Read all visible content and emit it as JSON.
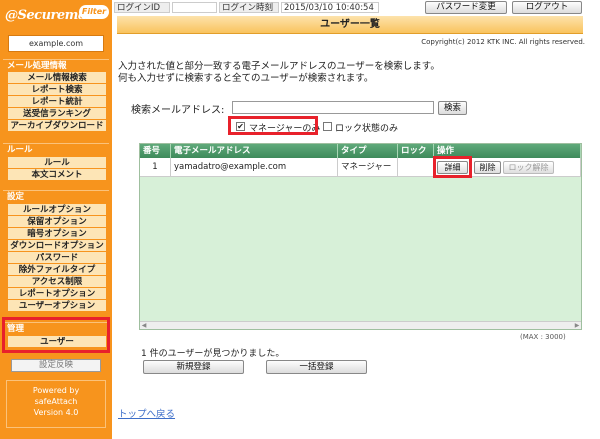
{
  "sidebar": {
    "logo_text": "@Securemail",
    "logo_badge": "Filter",
    "domain": "example.com",
    "sections": [
      {
        "title": "メール処理情報",
        "items": [
          "メール情報検索",
          "レポート検索",
          "レポート統計",
          "送受信ランキング",
          "アーカイブダウンロード"
        ]
      },
      {
        "title": "ルール",
        "items": [
          "ルール",
          "本文コメント"
        ]
      },
      {
        "title": "設定",
        "items": [
          "ルールオプション",
          "保留オプション",
          "暗号オプション",
          "ダウンロードオプション",
          "パスワード",
          "除外ファイルタイプ",
          "アクセス制限",
          "レポートオプション",
          "ユーザーオプション"
        ]
      },
      {
        "title": "管理",
        "items": [
          "ユーザー"
        ]
      }
    ],
    "apply_label": "設定反映",
    "powered_line1": "Powered by",
    "powered_line2": "safeAttach",
    "version": "Version 4.0"
  },
  "topbar": {
    "login_id_label": "ログインID",
    "login_time_label": "ログイン時刻",
    "login_time_value": "2015/03/10 10:40:54",
    "password_button": "パスワード変更",
    "logout_button": "ログアウト"
  },
  "page": {
    "title": "ユーザー一覧",
    "copyright": "Copyright(c) 2012 KTK INC. All rights reserved.",
    "desc_line1": "入力された値と部分一致する電子メールアドレスのユーザーを検索します。",
    "desc_line2": "何も入力せずに検索すると全てのユーザーが検索されます。"
  },
  "search": {
    "label": "検索メールアドレス:",
    "value": "",
    "button": "検索",
    "manager_only_label": "マネージャーのみ",
    "manager_only_checked": true,
    "locked_only_label": "ロック状態のみ",
    "locked_only_checked": false
  },
  "table": {
    "headers": [
      "番号",
      "電子メールアドレス",
      "タイプ",
      "ロック",
      "操作"
    ],
    "rows": [
      {
        "no": "1",
        "email": "yamadatro@example.com",
        "type": "マネージャー",
        "lock": "",
        "detail": "詳細",
        "delete": "削除",
        "unlock": "ロック解除"
      }
    ],
    "max_note": "(MAX : 3000)"
  },
  "result": {
    "found_text": "1 件のユーザーが見つかりました。",
    "new_button": "新規登録",
    "bulk_button": "一括登録"
  },
  "footer": {
    "back_link": "トップへ戻る"
  },
  "colors": {
    "sidebar": "#f7941d",
    "menu_item_bg": "#fde5b6",
    "highlight": "#e8212b",
    "table_bg": "#d7f0d8",
    "table_header": "#4a9766",
    "link": "#3d6ec9"
  }
}
